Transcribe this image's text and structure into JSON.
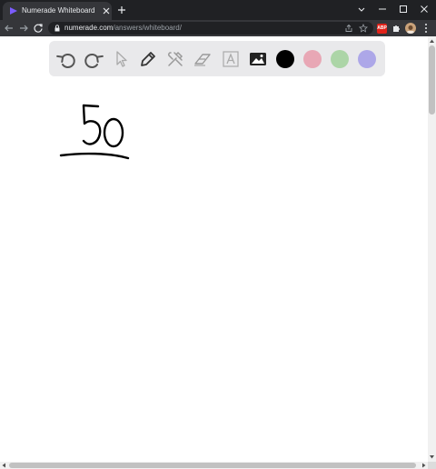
{
  "browser": {
    "tab": {
      "title": "Numerade Whiteboard"
    },
    "address": {
      "host": "numerade.com",
      "path": "/answers/whiteboard/"
    },
    "extensions": {
      "abp_label": "ABP"
    }
  },
  "whiteboard": {
    "tools": [
      {
        "name": "undo-icon"
      },
      {
        "name": "redo-icon"
      },
      {
        "name": "select-icon"
      },
      {
        "name": "pen-icon"
      },
      {
        "name": "tools-icon"
      },
      {
        "name": "eraser-icon"
      },
      {
        "name": "text-icon"
      },
      {
        "name": "image-icon"
      }
    ],
    "colors": [
      "#000000",
      "#e8a7b5",
      "#acd5a7",
      "#ada7e8"
    ],
    "canvas_text": "50"
  }
}
